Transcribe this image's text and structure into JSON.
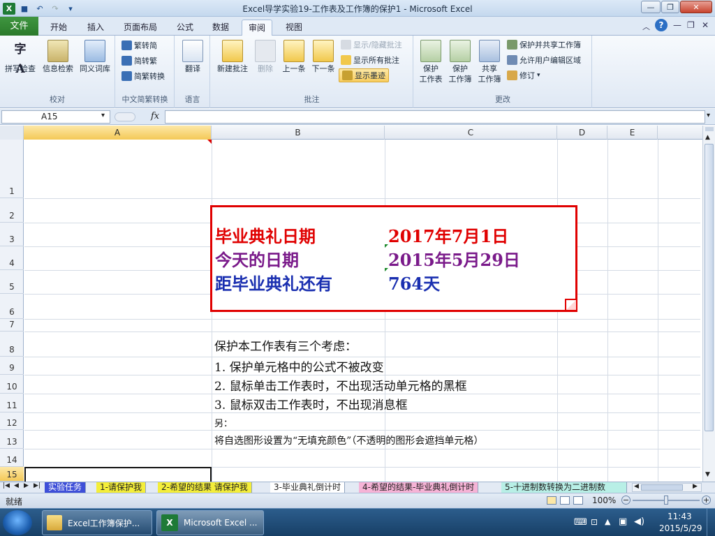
{
  "window": {
    "title": "Excel导学实验19-工作表及工作簿的保护1 - Microsoft Excel"
  },
  "tabs": [
    "文件",
    "开始",
    "插入",
    "页面布局",
    "公式",
    "数据",
    "审阅",
    "视图"
  ],
  "ribbon": {
    "proofing": {
      "label": "校对",
      "spell": "拼写检查",
      "research": "信息检索",
      "thesaurus": "同义词库"
    },
    "chinese": {
      "label": "中文简繁转换",
      "to_simplified": "繁转简",
      "to_traditional": "简转繁",
      "convert": "简繁转换"
    },
    "language": {
      "label": "语言",
      "translate": "翻译"
    },
    "comments": {
      "label": "批注",
      "new": "新建批注",
      "delete": "删除",
      "prev": "上一条",
      "next": "下一条",
      "show_hide": "显示/隐藏批注",
      "show_all": "显示所有批注",
      "show_ink": "显示墨迹"
    },
    "changes": {
      "label": "更改",
      "protect_sheet_1": "保护",
      "protect_sheet_2": "工作表",
      "protect_wb_1": "保护",
      "protect_wb_2": "工作簿",
      "share_wb_1": "共享",
      "share_wb_2": "工作簿",
      "protect_share": "保护并共享工作簿",
      "allow_edit": "允许用户编辑区域",
      "track": "修订"
    }
  },
  "formula_bar": {
    "name_box": "A15",
    "fx": "fx",
    "formula": ""
  },
  "columns": [
    "A",
    "B",
    "C",
    "D",
    "E"
  ],
  "rows": [
    "1",
    "2",
    "3",
    "4",
    "5",
    "6",
    "7",
    "8",
    "9",
    "10",
    "11",
    "12",
    "13",
    "14",
    "15"
  ],
  "comment_box": {
    "r1_label": "毕业典礼日期",
    "r1_value": "2017年7月1日",
    "r2_label": "今天的日期",
    "r2_value": "2015年5月29日",
    "r3_label": "距毕业典礼还有",
    "r3_value": "764天"
  },
  "notes": {
    "heading": "保护本工作表有三个考虑：",
    "item1": "1.  保护单元格中的公式不被改变",
    "item2": "2.  鼠标单击工作表时，不出现活动单元格的黑框",
    "item3": "3.  鼠标双击工作表时，不出现消息框",
    "another": "另：",
    "extra": "将自选图形设置为“无填充颜色”（不透明的图形会遮挡单元格）"
  },
  "sheet_tabs": [
    "实验任务",
    "1-请保护我",
    "2-希望的结果 请保护我",
    "3-毕业典礼倒计时",
    "4-希望的结果-毕业典礼倒计时",
    "5-十进制数转换为二进制数"
  ],
  "status": {
    "ready": "就绪",
    "zoom": "100%"
  },
  "taskbar": {
    "explorer": "Excel工作簿保护...",
    "excel": "Microsoft Excel ...",
    "time": "11:43",
    "date": "2015/5/29"
  },
  "colors": {
    "red": "#e00000",
    "purple": "#7a1a8a",
    "blue": "#1a2fb0"
  }
}
